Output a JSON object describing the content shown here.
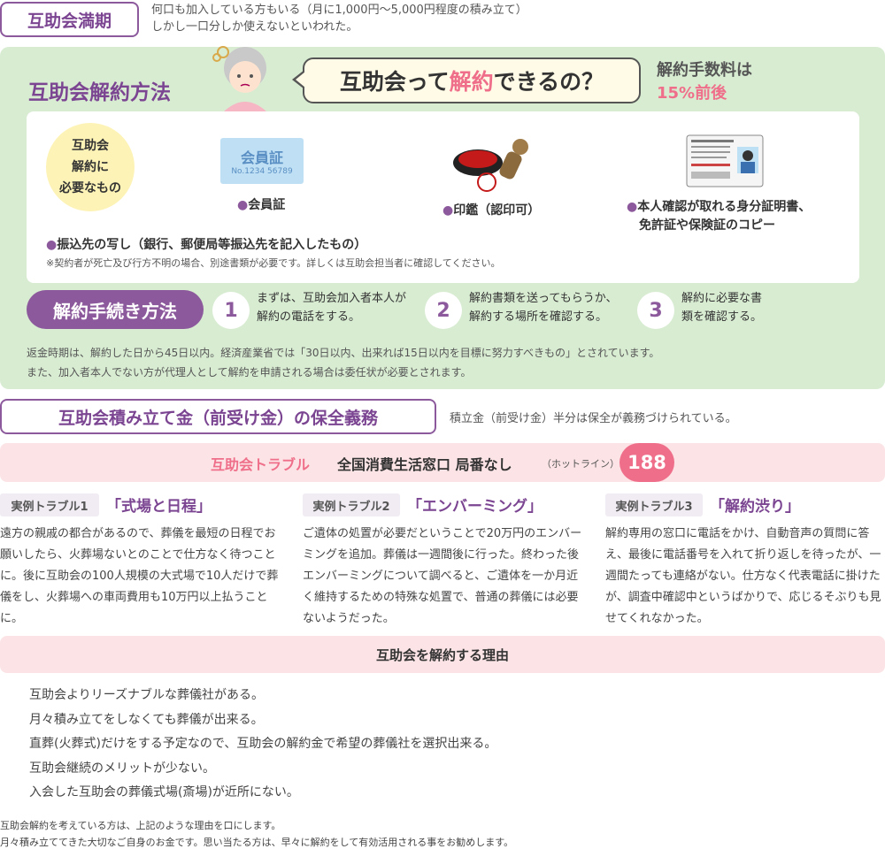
{
  "section1": {
    "tag": "互助会満期",
    "line1": "何口も加入している方もいる（月に1,000円〜5,000円程度の積み立て）",
    "line2": "しかし一口分しか使えないといわれた。"
  },
  "cancel": {
    "title": "互助会解約方法",
    "bubble_pre": "互助会って",
    "bubble_hl": "解約",
    "bubble_post": "できるの？",
    "fee_label": "解約手数料は",
    "fee_value": "15%前後",
    "need_line1": "互助会",
    "need_line2": "解約に",
    "need_line3": "必要なもの",
    "card_img_title": "会員証",
    "card_img_no": "No.1234 56789",
    "item_card": "会員証",
    "item_seal": "印鑑（認印可）",
    "item_id_line1": "本人確認が取れる身分証明書、",
    "item_id_line2": "免許証や保険証のコピー",
    "item_transfer": "振込先の写し（銀行、郵便局等振込先を記入したもの）",
    "note": "※契約者が死亡及び行方不明の場合、別途書類が必要です。詳しくは互助会担当者に確認してください。",
    "dot": "●"
  },
  "procedure": {
    "title": "解約手続き方法",
    "steps": [
      {
        "num": "1",
        "line1": "まずは、互助会加入者本人が",
        "line2": "解約の電話をする。"
      },
      {
        "num": "2",
        "line1": "解約書類を送ってもらうか、",
        "line2": "解約する場所を確認する。"
      },
      {
        "num": "3",
        "line1": "解約に必要な書",
        "line2": "類を確認する。"
      }
    ],
    "note1": "返金時期は、解約した日から45日以内。経済産業省では「30日以内、出来れば15日以内を目標に努力すべきもの」とされています。",
    "note2": "また、加入者本人でない方が代理人として解約を申請される場合は委任状が必要とされます。"
  },
  "section2": {
    "tag": "互助会積み立て金（前受け金）の保全義務",
    "text": "積立金（前受け金）半分は保全が義務づけられている。"
  },
  "trouble": {
    "title": "互助会トラブル",
    "subtitle": "全国消費生活窓口 局番なし",
    "hotline": "（ホットライン）",
    "number": "188",
    "cases": [
      {
        "label": "実例トラブル1",
        "title": "「式場と日程」",
        "body": [
          "遠方の親戚の都合があるので、葬儀を最短の日程でお",
          "願いしたら、火葬場ないとのことで仕方なく待つこと",
          "に。後に互助会の100人規模の大式場で10人だけで葬",
          "儀をし、火葬場への車両費用も10万円以上払うこと",
          "に。"
        ]
      },
      {
        "label": "実例トラブル2",
        "title": "「エンバーミング」",
        "body": [
          "ご遺体の処置が必要だということで20万円のエンバー",
          "ミングを追加。葬儀は一週間後に行った。終わった後",
          "エンバーミングについて調べると、ご遺体を一か月近",
          "く維持するための特殊な処置で、普通の葬儀には必要",
          "ないようだった。"
        ]
      },
      {
        "label": "実例トラブル3",
        "title": "「解約渋り」",
        "body": [
          "解約専用の窓口に電話をかけ、自動音声の質問に答",
          "え、最後に電話番号を入れて折り返しを待ったが、一",
          "週間たっても連絡がない。仕方なく代表電話に掛けた",
          "が、調査中確認中というばかりで、応じるそぶりも見",
          "せてくれなかった。"
        ]
      }
    ]
  },
  "reasons": {
    "title": "互助会を解約する理由",
    "items": [
      "互助会よりリーズナブルな葬儀社がある。",
      "月々積み立てをしなくても葬儀が出来る。",
      "直葬(火葬式)だけをする予定なので、互助会の解約金で希望の葬儀社を選択出来る。",
      "互助会継続のメリットが少ない。",
      "入会した互助会の葬儀式場(斎場)が近所にない。"
    ]
  },
  "footer": {
    "line1": "互助会解約を考えている方は、上記のような理由を口にします。",
    "line2": "月々積み立ててきた大切なご自身のお金です。思い当たる方は、早々に解約をして有効活用される事をお勧めします。"
  },
  "colors": {
    "purple": "#8c5a9c",
    "green_panel": "#d8ecd2",
    "pink": "#ef6f8a",
    "pink_bar": "#fce4e6"
  },
  "icons": {
    "grandma": "worried-grandma-illustration",
    "seal": "hanko-seal-illustration",
    "idcard": "license-card-illustration"
  }
}
